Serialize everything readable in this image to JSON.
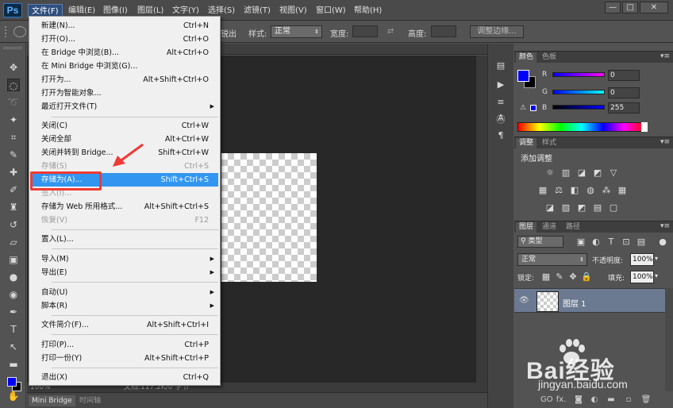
{
  "app": {
    "logo": "Ps"
  },
  "menubar": {
    "items": [
      "文件(F)",
      "编辑(E)",
      "图像(I)",
      "图层(L)",
      "文字(Y)",
      "选择(S)",
      "滤镜(T)",
      "视图(V)",
      "窗口(W)",
      "帮助(H)"
    ],
    "window_buttons": [
      "—",
      "□",
      "✕"
    ]
  },
  "options_bar": {
    "partial_label": "锐出",
    "style_label": "样式:",
    "style_value": "正常",
    "width_label": "宽度:",
    "height_label": "高度:",
    "refine_edge": "调整边缘..."
  },
  "document": {
    "zoom": "100%",
    "status_text": "文档:117.2K/0 字节"
  },
  "bottom_tabs": [
    "Mini Bridge",
    "时间轴"
  ],
  "file_menu": {
    "items": [
      {
        "label": "新建(N)...",
        "shortcut": "Ctrl+N",
        "submenu": false,
        "disabled": false
      },
      {
        "label": "打开(O)...",
        "shortcut": "Ctrl+O",
        "submenu": false,
        "disabled": false
      },
      {
        "label": "在 Bridge 中浏览(B)...",
        "shortcut": "Alt+Ctrl+O",
        "submenu": false,
        "disabled": false
      },
      {
        "label": "在 Mini Bridge 中浏览(G)...",
        "shortcut": "",
        "submenu": false,
        "disabled": false
      },
      {
        "label": "打开为...",
        "shortcut": "Alt+Shift+Ctrl+O",
        "submenu": false,
        "disabled": false
      },
      {
        "label": "打开为智能对象...",
        "shortcut": "",
        "submenu": false,
        "disabled": false
      },
      {
        "label": "最近打开文件(T)",
        "shortcut": "",
        "submenu": true,
        "disabled": false
      },
      {
        "label": "关闭(C)",
        "shortcut": "Ctrl+W",
        "submenu": false,
        "disabled": false
      },
      {
        "label": "关闭全部",
        "shortcut": "Alt+Ctrl+W",
        "submenu": false,
        "disabled": false
      },
      {
        "label": "关闭并转到 Bridge...",
        "shortcut": "Shift+Ctrl+W",
        "submenu": false,
        "disabled": false
      },
      {
        "label": "存储(S)",
        "shortcut": "Ctrl+S",
        "submenu": false,
        "disabled": true
      },
      {
        "label": "存储为(A)...",
        "shortcut": "Shift+Ctrl+S",
        "submenu": false,
        "disabled": false
      },
      {
        "label": "签入(I)...",
        "shortcut": "",
        "submenu": false,
        "disabled": true
      },
      {
        "label": "存储为 Web 所用格式...",
        "shortcut": "Alt+Shift+Ctrl+S",
        "submenu": false,
        "disabled": false
      },
      {
        "label": "恢复(V)",
        "shortcut": "F12",
        "submenu": false,
        "disabled": true
      },
      {
        "label": "置入(L)...",
        "shortcut": "",
        "submenu": false,
        "disabled": false
      },
      {
        "label": "导入(M)",
        "shortcut": "",
        "submenu": true,
        "disabled": false
      },
      {
        "label": "导出(E)",
        "shortcut": "",
        "submenu": true,
        "disabled": false
      },
      {
        "label": "自动(U)",
        "shortcut": "",
        "submenu": true,
        "disabled": false
      },
      {
        "label": "脚本(R)",
        "shortcut": "",
        "submenu": true,
        "disabled": false
      },
      {
        "label": "文件简介(F)...",
        "shortcut": "Alt+Shift+Ctrl+I",
        "submenu": false,
        "disabled": false
      },
      {
        "label": "打印(P)...",
        "shortcut": "Ctrl+P",
        "submenu": false,
        "disabled": false
      },
      {
        "label": "打印一份(Y)",
        "shortcut": "Alt+Shift+Ctrl+P",
        "submenu": false,
        "disabled": false
      },
      {
        "label": "退出(X)",
        "shortcut": "Ctrl+Q",
        "submenu": false,
        "disabled": false
      }
    ],
    "highlighted_label": "存储为(A)..."
  },
  "color_panel": {
    "tabs": [
      "颜色",
      "色板"
    ],
    "channels": [
      {
        "label": "R",
        "value": "0"
      },
      {
        "label": "G",
        "value": "0"
      },
      {
        "label": "B",
        "value": "255"
      }
    ],
    "foreground_color": "#0000ff",
    "background_color": "#000000"
  },
  "adjustments_panel": {
    "tabs": [
      "调整",
      "样式"
    ],
    "title": "添加调整"
  },
  "layers_panel": {
    "tabs": [
      "图层",
      "通道",
      "路径"
    ],
    "filter_kind": "类型",
    "blend_mode": "正常",
    "opacity_label": "不透明度:",
    "opacity_value": "100%",
    "lock_label": "锁定:",
    "fill_label": "填充:",
    "fill_value": "100%",
    "layers": [
      {
        "name": "图层 1",
        "visible": true
      }
    ],
    "bottom_icons": [
      "GO",
      "fx."
    ]
  },
  "watermark": {
    "text": "Bai经验",
    "url": "jingyan.baidu.com"
  },
  "accent": {
    "menu_highlight": "#3296f0",
    "callout_red": "#ef3a35"
  }
}
